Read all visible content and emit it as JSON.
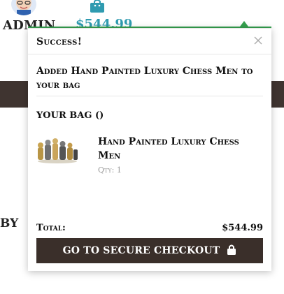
{
  "header": {
    "admin_label": "ADMIN",
    "bag_total": "$544.99",
    "icons": {
      "avatar": "avatar",
      "bag": "shopping-bag-icon"
    }
  },
  "background": {
    "by_text": "BY"
  },
  "popup": {
    "success_title": "Success!",
    "added_message": "Added Hand Painted Luxury Chess Men to your bag",
    "bag_title": "YOUR BAG ()",
    "item": {
      "name": "Hand Painted Luxury Chess Men",
      "qty": "Qty: 1"
    },
    "total_label": "Total:",
    "total_value": "$544.99",
    "checkout_label": "GO TO SECURE CHECKOUT",
    "colors": {
      "button_bg": "#3a2f2a",
      "accent_green": "#35a04f",
      "price_blue": "#2f9bb0",
      "band_dark": "#3f3430"
    }
  }
}
